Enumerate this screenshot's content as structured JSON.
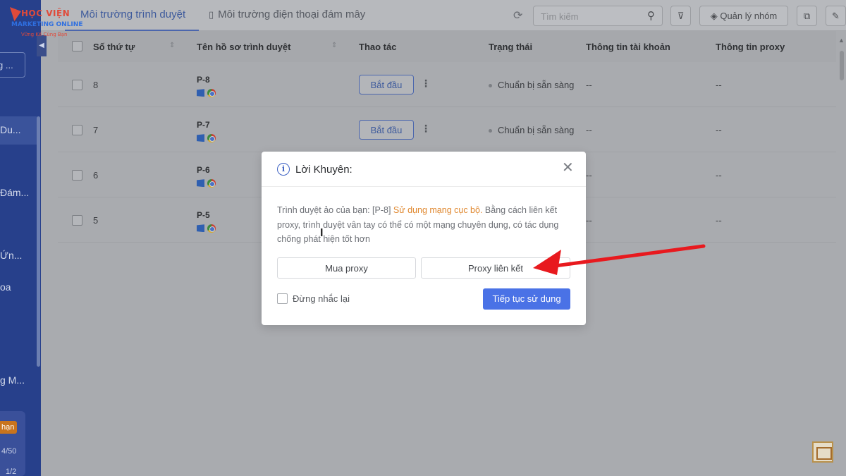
{
  "sidebar": {
    "logo": {
      "line1": "HỌC VIỆN",
      "line2": "MARKETING ONLINE",
      "line3": "Vững Kế Cùng Bạn"
    },
    "button_text": "g ...",
    "items": [
      {
        "label": "Du..."
      },
      {
        "label": "Đám..."
      },
      {
        "label": "Ứn..."
      },
      {
        "label": "oa"
      },
      {
        "label": "g M..."
      }
    ],
    "badge": "hạn",
    "count1": "4/50",
    "count2": "1/2"
  },
  "topbar": {
    "tabs": [
      {
        "label": "Môi trường trình duyệt"
      },
      {
        "label": "Môi trường điện thoại đám mây"
      }
    ],
    "search_placeholder": "Tìm kiếm",
    "group_button": "Quản lý nhóm"
  },
  "table": {
    "headers": {
      "index": "Số thứ tự",
      "profile": "Tên hồ sơ trình duyệt",
      "action": "Thao tác",
      "status": "Trạng thái",
      "account": "Thông tin tài khoản",
      "proxy": "Thông tin proxy"
    },
    "rows": [
      {
        "index": "8",
        "name": "P-8",
        "action": "Bắt đầu",
        "status": "Chuẩn bị sẵn sàng",
        "account": "--",
        "proxy": "--"
      },
      {
        "index": "7",
        "name": "P-7",
        "action": "Bắt đầu",
        "status": "Chuẩn bị sẵn sàng",
        "account": "--",
        "proxy": "--"
      },
      {
        "index": "6",
        "name": "P-6",
        "account": "--",
        "proxy": "--"
      },
      {
        "index": "5",
        "name": "P-5",
        "account": "--",
        "proxy": "--"
      }
    ]
  },
  "modal": {
    "title": "Lời Khuyên:",
    "message_part1": "Trình duyệt ảo của bạn: [P-8] ",
    "message_warning": "Sử dụng mạng cục bộ.",
    "message_part2": " Bằng cách liên kết proxy, trình duyệt vân tay có thể có một mạng chuyên dụng, có tác dụng chống phát hiện tốt hơn",
    "buy_proxy": "Mua proxy",
    "link_proxy": "Proxy liên kết",
    "dont_remind": "Đừng nhắc lại",
    "continue": "Tiếp tục sử dụng"
  },
  "colors": {
    "sidebar": "#27408b",
    "primary": "#4a72e6",
    "warning": "#e0882f",
    "arrow": "#e8191e"
  },
  "icons": [
    "info-icon",
    "close-icon",
    "search-icon",
    "refresh-icon",
    "filter-icon",
    "layers-icon",
    "copy-icon",
    "pin-icon",
    "windows-icon",
    "chrome-icon",
    "more-icon"
  ]
}
